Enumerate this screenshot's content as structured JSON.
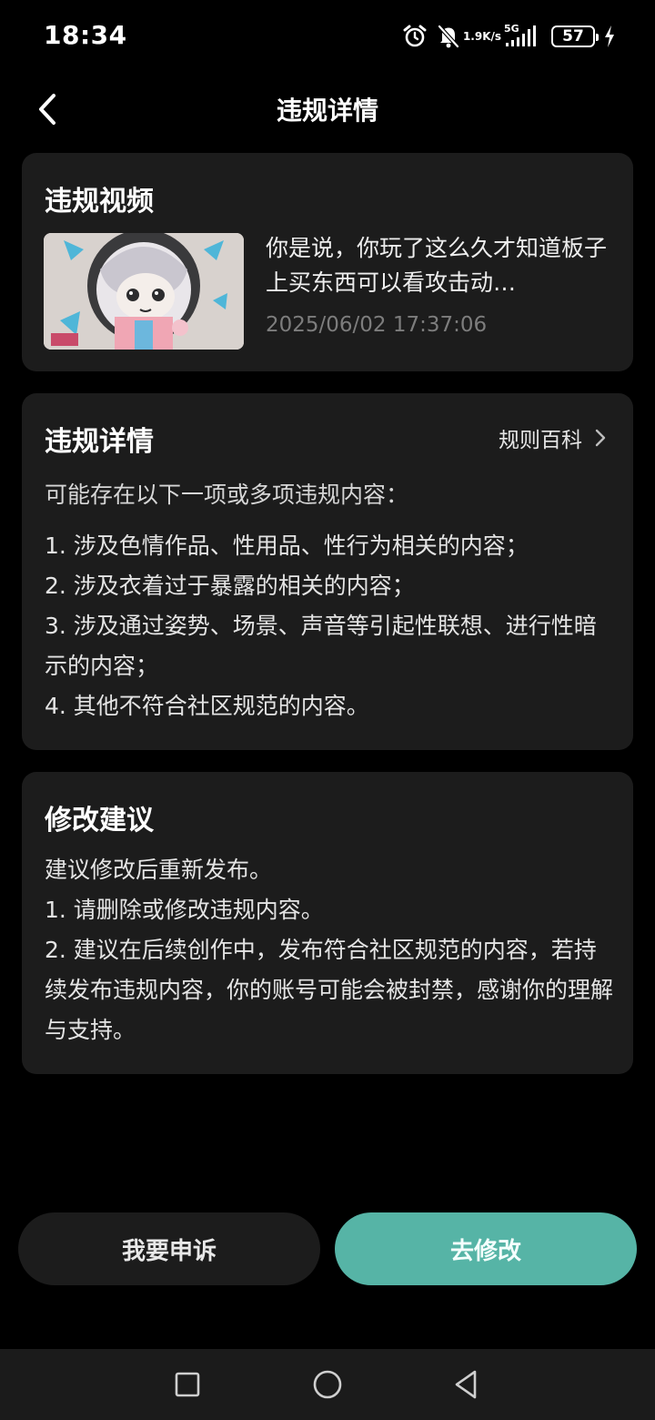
{
  "status_bar": {
    "time": "18:34",
    "net_speed_value": "1.9",
    "net_speed_unit": "K/s",
    "network_type": "5G",
    "battery_level": "57",
    "icons": [
      "alarm-icon",
      "bell-off-icon",
      "signal-icon",
      "battery-icon",
      "charging-icon"
    ]
  },
  "header": {
    "title": "违规详情",
    "back_icon": "chevron-left-icon"
  },
  "video_card": {
    "heading": "违规视频",
    "video_title": "你是说，你玩了这么久才知道板子上买东西可以看攻击动…",
    "timestamp": "2025/06/02 17:37:06"
  },
  "detail_card": {
    "heading": "违规详情",
    "rules_link_label": "规则百科",
    "intro": "可能存在以下一项或多项违规内容：",
    "items": [
      "1. 涉及色情作品、性用品、性行为相关的内容；",
      "2. 涉及衣着过于暴露的相关的内容；",
      "3. 涉及通过姿势、场景、声音等引起性联想、进行性暗示的内容；",
      "4. 其他不符合社区规范的内容。"
    ]
  },
  "suggestion_card": {
    "heading": "修改建议",
    "lines": [
      "建议修改后重新发布。",
      "1. 请删除或修改违规内容。",
      "2. 建议在后续创作中，发布符合社区规范的内容，若持续发布违规内容，你的账号可能会被封禁，感谢你的理解与支持。"
    ]
  },
  "actions": {
    "appeal_label": "我要申诉",
    "modify_label": "去修改"
  },
  "colors": {
    "accent": "#56b4a6",
    "card_bg": "#1c1c1c",
    "page_bg": "#000000",
    "muted_text": "#7d7d7d"
  },
  "nav_bar": {
    "icons": [
      "recent-apps-icon",
      "home-icon",
      "back-icon"
    ]
  }
}
